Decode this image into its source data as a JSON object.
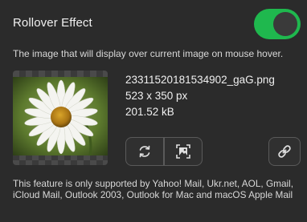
{
  "header": {
    "title": "Rollover Effect",
    "toggle_on": true
  },
  "description": "The image that will display over current image on mouse hover.",
  "file": {
    "name": "23311520181534902_gaG.png",
    "dimensions": "523 x 350 px",
    "size": "201.52 kB"
  },
  "actions": {
    "replace_icon": "replace-icon",
    "edit_icon": "image-edit-icon",
    "link_icon": "link-icon"
  },
  "note": "This feature is only supported by Yahoo! Mail, Ukr.net, AOL, Gmail, iCloud Mail, Outlook 2003, Outlook for Mac and macOS Apple Mail",
  "colors": {
    "background": "#2b2b2b",
    "toggle_on": "#1fb84e",
    "text": "#e6e6e6"
  }
}
